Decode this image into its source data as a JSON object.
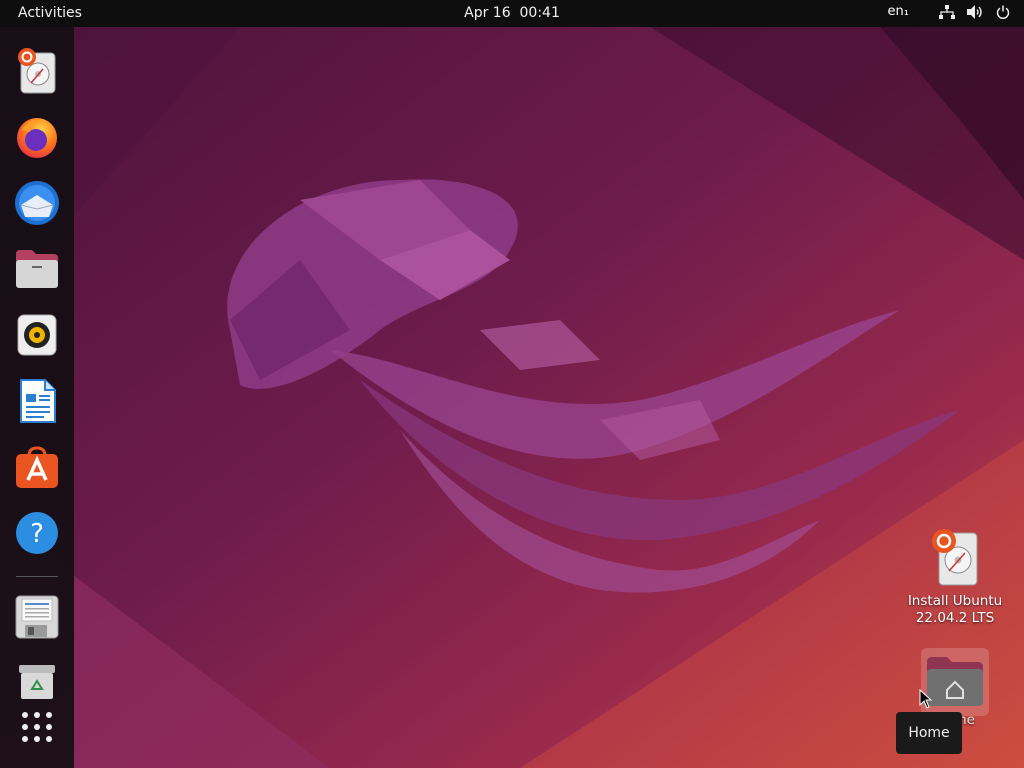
{
  "topbar": {
    "activities_label": "Activities",
    "date": "Apr 16",
    "time": "00:41",
    "language": "en₁"
  },
  "dock": {
    "items": [
      {
        "name": "Install Ubuntu 22.04.2 LTS",
        "icon": "installer-icon"
      },
      {
        "name": "Firefox",
        "icon": "firefox-icon"
      },
      {
        "name": "Thunderbird",
        "icon": "thunderbird-icon"
      },
      {
        "name": "Files",
        "icon": "files-icon"
      },
      {
        "name": "Rhythmbox",
        "icon": "rhythmbox-icon"
      },
      {
        "name": "LibreOffice Writer",
        "icon": "writer-icon"
      },
      {
        "name": "Ubuntu Software",
        "icon": "software-icon"
      },
      {
        "name": "Help",
        "icon": "help-icon"
      },
      {
        "name": "Save",
        "icon": "floppy-icon"
      },
      {
        "name": "Trash",
        "icon": "trash-icon"
      },
      {
        "name": "Show Applications",
        "icon": "app-grid-icon"
      }
    ]
  },
  "desktop": {
    "install_label_line1": "Install Ubuntu",
    "install_label_line2": "22.04.2 LTS",
    "home_label": "Home",
    "tooltip": "Home"
  },
  "colors": {
    "topbar": "#0e0e0e",
    "dock": "#140e12",
    "wallpaper_dark": "#3a0f30",
    "wallpaper_mid": "#7a1f52",
    "wallpaper_orange": "#d8553a",
    "ubuntu_orange": "#e95420"
  }
}
